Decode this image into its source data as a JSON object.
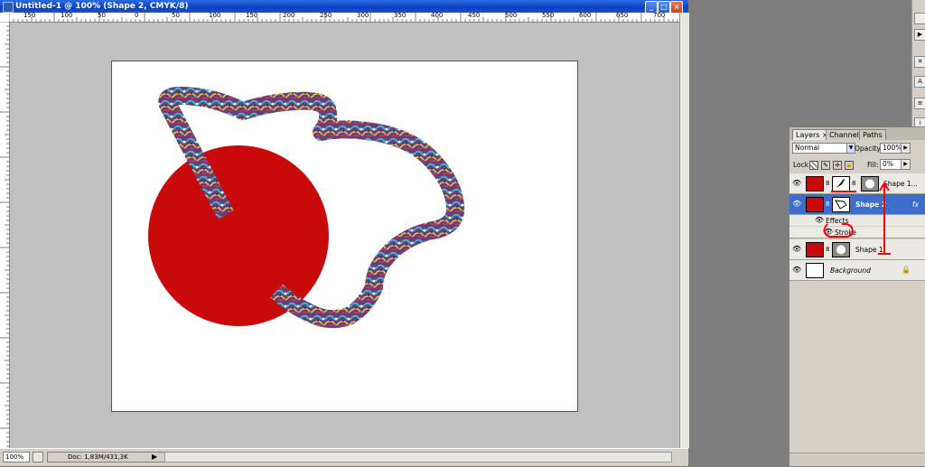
{
  "window": {
    "title": "Untitled-1 @ 100% (Shape 2, CMYK/8)",
    "min": "_",
    "max": "□",
    "close": "×"
  },
  "ruler": {
    "top_labels": [
      "150",
      "100",
      "50",
      "0",
      "50",
      "100",
      "150",
      "200",
      "250",
      "300",
      "350",
      "400",
      "450",
      "500",
      "550",
      "600",
      "650",
      "700"
    ]
  },
  "statusbar": {
    "zoom": "100%",
    "doc": "Doc: 1,83M/431,3K",
    "arrow": "▶"
  },
  "colors": {
    "red": "#c80a0a",
    "canvas_bg": "#c0c0c0",
    "selection": "#3d6cc9",
    "annotation": "#ff0000"
  },
  "layers_panel": {
    "tabs": [
      "Layers ×",
      "Channels",
      "Paths"
    ],
    "blend_mode": "Normal",
    "opacity_label": "Opacity:",
    "opacity_value": "100%",
    "lock_label": "Lock:",
    "fill_label": "Fill:",
    "fill_value": "0%",
    "layers": [
      {
        "name": "Shape 1...",
        "thumb": "red",
        "mask": "brush",
        "extra": "circle",
        "selected": false
      },
      {
        "name": "Shape 2",
        "thumb": "red",
        "mask": "shape",
        "fx": "fx",
        "selected": true
      },
      {
        "name": "Effects",
        "sub": true
      },
      {
        "name": "Stroke",
        "sub": true
      },
      {
        "name": "Shape 1",
        "thumb": "red",
        "mask": "circle",
        "selected": false
      },
      {
        "name": "Background",
        "thumb": "white",
        "locked": true,
        "selected": false
      }
    ]
  }
}
